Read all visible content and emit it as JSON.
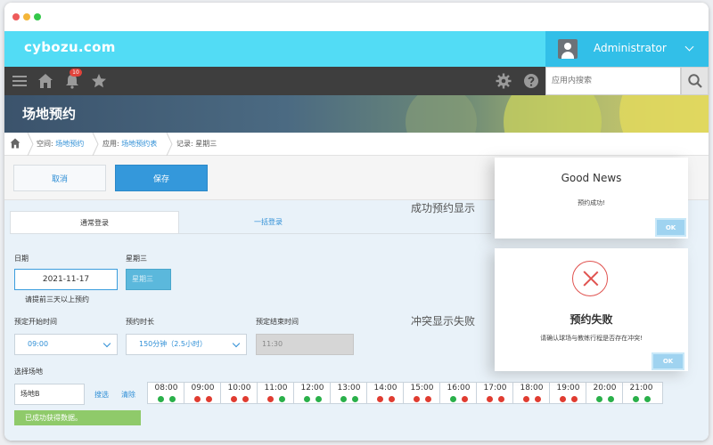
{
  "window": {
    "controls": [
      "close",
      "minimize",
      "maximize"
    ]
  },
  "header": {
    "logo": "cybozu.com",
    "user": "Administrator"
  },
  "nav": {
    "notification_count": "10",
    "search_placeholder": "应用内搜索"
  },
  "banner": {
    "title": "场地预约"
  },
  "breadcrumb": {
    "space_prefix": "空间: ",
    "space_name": "场地预约",
    "app_prefix": "应用: ",
    "app_name": "场地预约表",
    "record": "记录: 星期三"
  },
  "toolbar": {
    "cancel_label": "取消",
    "save_label": "保存"
  },
  "tabs": [
    {
      "label": "通常登录",
      "active": true
    },
    {
      "label": "一括登录",
      "active": false
    }
  ],
  "form": {
    "date_label": "日期",
    "date_value": "2021-11-17",
    "weekday_label": "星期三",
    "weekday_value": "星期三",
    "hint": "请提前三天以上预约",
    "start_label": "预定开始时间",
    "start_value": "09:00",
    "duration_label": "预约时长",
    "duration_value": "150分钟（2.5小时）",
    "end_label": "预定结束时间",
    "end_value": "11:30",
    "venue_label": "选择场地",
    "venue_value": "场地B",
    "search_link": "搜选",
    "clear_link": "清除",
    "success_message": "已成功获得数据。"
  },
  "timeline": {
    "slots": [
      {
        "time": "08:00",
        "dots": [
          "green",
          "green"
        ]
      },
      {
        "time": "09:00",
        "dots": [
          "red",
          "red"
        ]
      },
      {
        "time": "10:00",
        "dots": [
          "red",
          "red"
        ]
      },
      {
        "time": "11:00",
        "dots": [
          "red",
          "green"
        ]
      },
      {
        "time": "12:00",
        "dots": [
          "green",
          "green"
        ]
      },
      {
        "time": "13:00",
        "dots": [
          "green",
          "green"
        ]
      },
      {
        "time": "14:00",
        "dots": [
          "red",
          "red"
        ]
      },
      {
        "time": "15:00",
        "dots": [
          "red",
          "red"
        ]
      },
      {
        "time": "16:00",
        "dots": [
          "green",
          "red"
        ]
      },
      {
        "time": "17:00",
        "dots": [
          "red",
          "red"
        ]
      },
      {
        "time": "18:00",
        "dots": [
          "red",
          "red"
        ]
      },
      {
        "time": "19:00",
        "dots": [
          "red",
          "red"
        ]
      },
      {
        "time": "20:00",
        "dots": [
          "green",
          "green"
        ]
      },
      {
        "time": "21:00",
        "dots": [
          "green",
          "green"
        ]
      }
    ],
    "colors": {
      "green": "#2ab04a",
      "red": "#e03c31"
    }
  },
  "annotations": {
    "success_caption": "成功预约显示",
    "conflict_caption": "冲突显示失败"
  },
  "dialogs": {
    "success": {
      "title": "Good News",
      "message": "预约成功!",
      "ok_label": "OK"
    },
    "failure": {
      "title": "预约失败",
      "message": "请确认球场与教练行程是否存在冲突!",
      "ok_label": "OK"
    }
  },
  "colors": {
    "brand": "#52dcf5",
    "user_box": "#32bfe8",
    "nav": "#3e3e3e",
    "save": "#3498db",
    "error": "#e0524f"
  }
}
